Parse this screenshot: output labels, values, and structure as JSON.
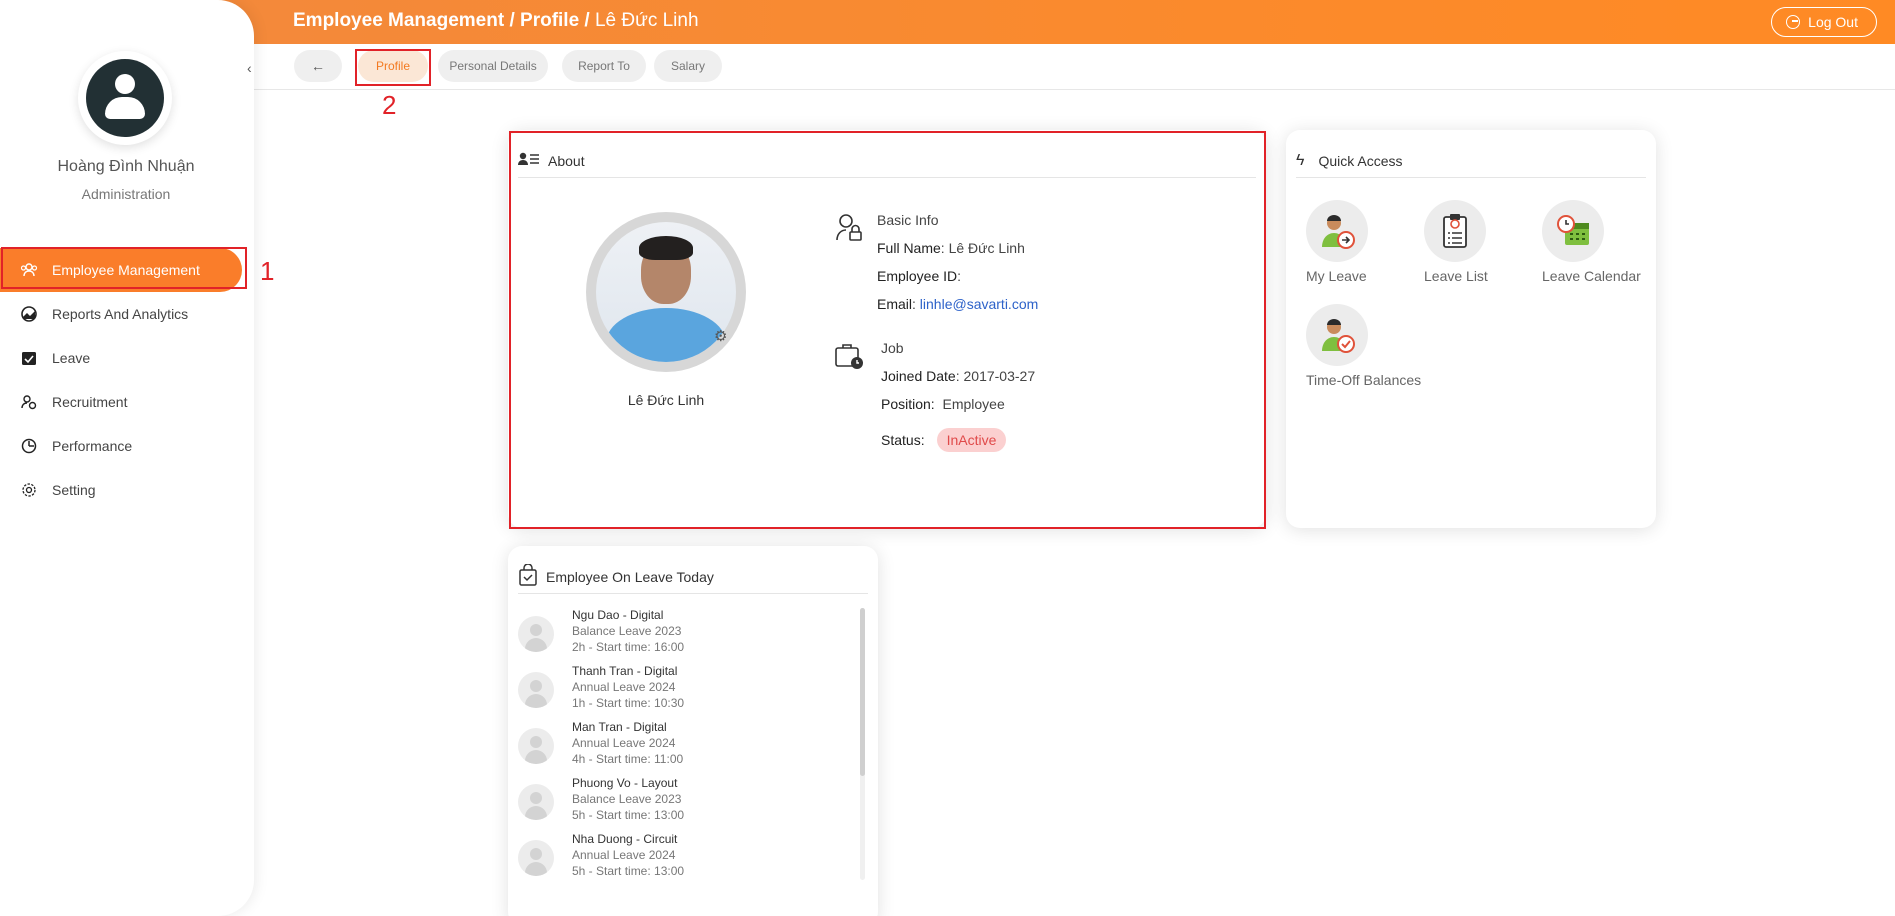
{
  "header": {
    "breadcrumb_1": "Employee Management /",
    "breadcrumb_2": "Profile /",
    "breadcrumb_3": "Lê Đức Linh",
    "logout_label": "Log Out"
  },
  "sidebar": {
    "user_name": "Hoàng Đình Nhuận",
    "user_role": "Administration",
    "items": [
      {
        "label": "Employee Management",
        "icon": "users-icon",
        "active": true
      },
      {
        "label": "Reports And Analytics",
        "icon": "chart-icon"
      },
      {
        "label": "Leave",
        "icon": "calendar-check-icon"
      },
      {
        "label": "Recruitment",
        "icon": "recruit-icon"
      },
      {
        "label": "Performance",
        "icon": "performance-icon"
      },
      {
        "label": "Setting",
        "icon": "gear-icon"
      }
    ]
  },
  "annotations": {
    "one": "1",
    "two": "2"
  },
  "tabs": [
    {
      "label": "Profile",
      "active": true
    },
    {
      "label": "Personal Details"
    },
    {
      "label": "Report To"
    },
    {
      "label": "Salary"
    }
  ],
  "about": {
    "title": "About",
    "person_name": "Lê Đức Linh",
    "basic_info_title": "Basic Info",
    "full_name_label": "Full Name",
    "full_name_value": ": Lê Đức Linh",
    "employee_id_label": "Employee ID",
    "employee_id_value": ":",
    "email_label": "Email",
    "email_sep": ": ",
    "email_value": "linhle@savarti.com",
    "job_title": "Job",
    "joined_label": "Joined Date",
    "joined_value": ": 2017-03-27",
    "position_label": "Position:",
    "position_value": "Employee",
    "status_label": "Status:",
    "status_value": "InActive"
  },
  "quick_access": {
    "title": "Quick Access",
    "items": [
      "My Leave",
      "Leave List",
      "Leave Calendar",
      "Time-Off Balances"
    ]
  },
  "leave_today": {
    "title": "Employee On Leave Today",
    "rows": [
      {
        "name": "Ngu Dao - Digital",
        "type": "Balance Leave 2023",
        "time": "2h - Start time: 16:00"
      },
      {
        "name": "Thanh Tran - Digital",
        "type": "Annual Leave 2024",
        "time": "1h - Start time: 10:30"
      },
      {
        "name": "Man Tran - Digital",
        "type": "Annual Leave 2024",
        "time": "4h - Start time: 11:00"
      },
      {
        "name": "Phuong Vo - Layout",
        "type": "Balance Leave 2023",
        "time": "5h - Start time: 13:00"
      },
      {
        "name": "Nha Duong - Circuit",
        "type": "Annual Leave 2024",
        "time": "5h - Start time: 13:00"
      }
    ]
  },
  "colors": {
    "accent": "#fa7d2a",
    "annotation": "#e12228",
    "link": "#2d62c9"
  }
}
